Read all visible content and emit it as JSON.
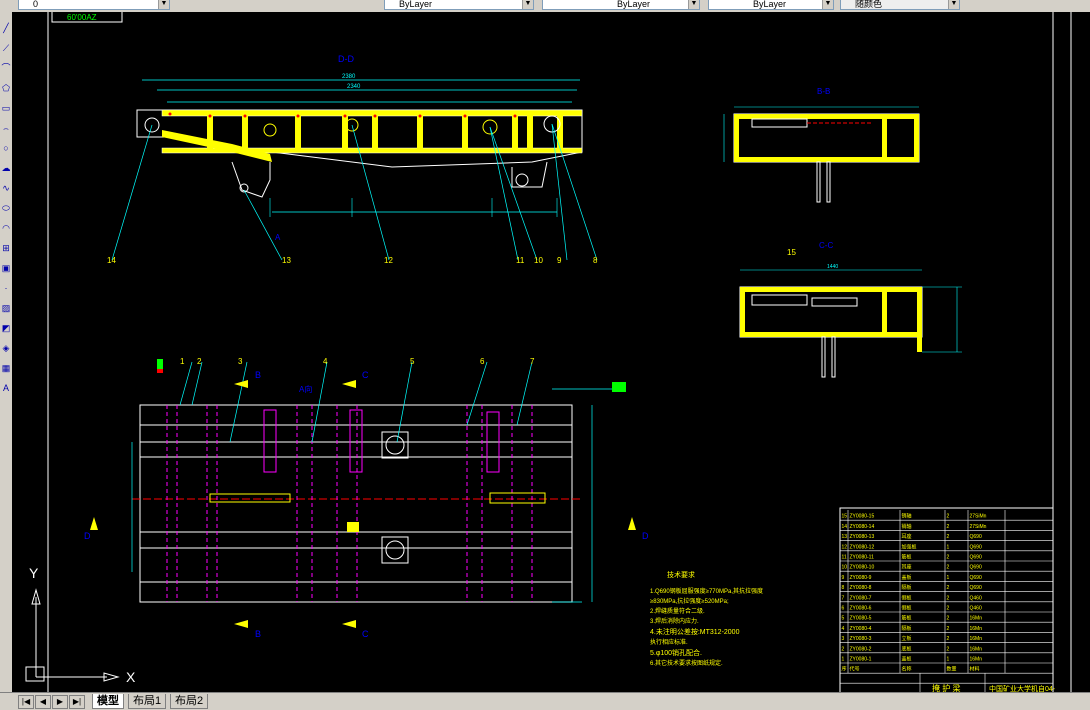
{
  "toolbar": {
    "layer_value": "0",
    "color_value": "ByLayer",
    "linetype_value": "ByLayer",
    "lineweight_value": "ByLayer",
    "plotstyle_value": "随颜色"
  },
  "drawing": {
    "top_label": "60'00AZ",
    "section_dd": "D-D",
    "section_bb": "B-B",
    "section_cc": "C-C",
    "view_a": "A向",
    "label_b": "B",
    "label_c": "C",
    "label_d": "D",
    "label_a": "A",
    "dim_total": "2380",
    "dim_2340": "2340",
    "dim_1440": "1440",
    "dim_5": "5",
    "callouts_side": [
      "14",
      "13",
      "12",
      "11",
      "10",
      "9",
      "8"
    ],
    "callouts_plan": [
      "1",
      "2",
      "3",
      "4",
      "5",
      "6",
      "7"
    ],
    "callout_15": "15",
    "axis_x": "X",
    "axis_y": "Y"
  },
  "tech_notes": {
    "title": "技术要求",
    "lines": [
      "1.Q690钢板屈服强度≥770MPa,其抗拉强度",
      "  ≥830MPa,抗拉强度≥520MPa;",
      "2.焊缝质量符合二级.",
      "3.焊后消除内应力.",
      "4.未注明公差按:MT312-2000",
      "  执行相应标准.",
      "5.φ100销孔配合.",
      "6.其它技术要求按图纸规定."
    ]
  },
  "bom": {
    "rows": [
      {
        "no": "15",
        "code": "ZY0080-15",
        "name": "销轴",
        "qty": "2",
        "mat": "27SiMn"
      },
      {
        "no": "14",
        "code": "ZY0080-14",
        "name": "销轴",
        "qty": "2",
        "mat": "27SiMn"
      },
      {
        "no": "13",
        "code": "ZY0080-13",
        "name": "耳座",
        "qty": "2",
        "mat": "Q690"
      },
      {
        "no": "12",
        "code": "ZY0080-12",
        "name": "加强板",
        "qty": "1",
        "mat": "Q690"
      },
      {
        "no": "11",
        "code": "ZY0080-11",
        "name": "筋板",
        "qty": "2",
        "mat": "Q690"
      },
      {
        "no": "10",
        "code": "ZY0080-10",
        "name": "耳座",
        "qty": "2",
        "mat": "Q690"
      },
      {
        "no": "9",
        "code": "ZY0080-9",
        "name": "盖板",
        "qty": "1",
        "mat": "Q690"
      },
      {
        "no": "8",
        "code": "ZY0080-8",
        "name": "隔板",
        "qty": "2",
        "mat": "Q690"
      },
      {
        "no": "7",
        "code": "ZY0080-7",
        "name": "侧板",
        "qty": "2",
        "mat": "Q460"
      },
      {
        "no": "6",
        "code": "ZY0080-6",
        "name": "侧板",
        "qty": "2",
        "mat": "Q460"
      },
      {
        "no": "5",
        "code": "ZY0080-5",
        "name": "筋板",
        "qty": "2",
        "mat": "16Mn"
      },
      {
        "no": "4",
        "code": "ZY0080-4",
        "name": "隔板",
        "qty": "2",
        "mat": "16Mn"
      },
      {
        "no": "3",
        "code": "ZY0080-3",
        "name": "立板",
        "qty": "2",
        "mat": "16Mn"
      },
      {
        "no": "2",
        "code": "ZY0080-2",
        "name": "底板",
        "qty": "2",
        "mat": "16Mn"
      },
      {
        "no": "1",
        "code": "ZY0080-1",
        "name": "盖板",
        "qty": "1",
        "mat": "16Mn"
      }
    ],
    "header": {
      "no": "序",
      "code": "代号",
      "name": "名称",
      "qty": "数量",
      "mat": "材料"
    },
    "title_block_name": "掩 护 梁",
    "title_block_school": "中国矿业大学机自04-"
  },
  "tabs": {
    "model": "模型",
    "layout1": "布局1",
    "layout2": "布局2"
  },
  "colors": {
    "background": "#000000",
    "yellow": "#ffff00",
    "cyan": "#00ffff",
    "magenta": "#ff00ff",
    "red": "#ff0000",
    "white": "#ffffff",
    "green": "#00ff00",
    "blue": "#0000ff"
  }
}
